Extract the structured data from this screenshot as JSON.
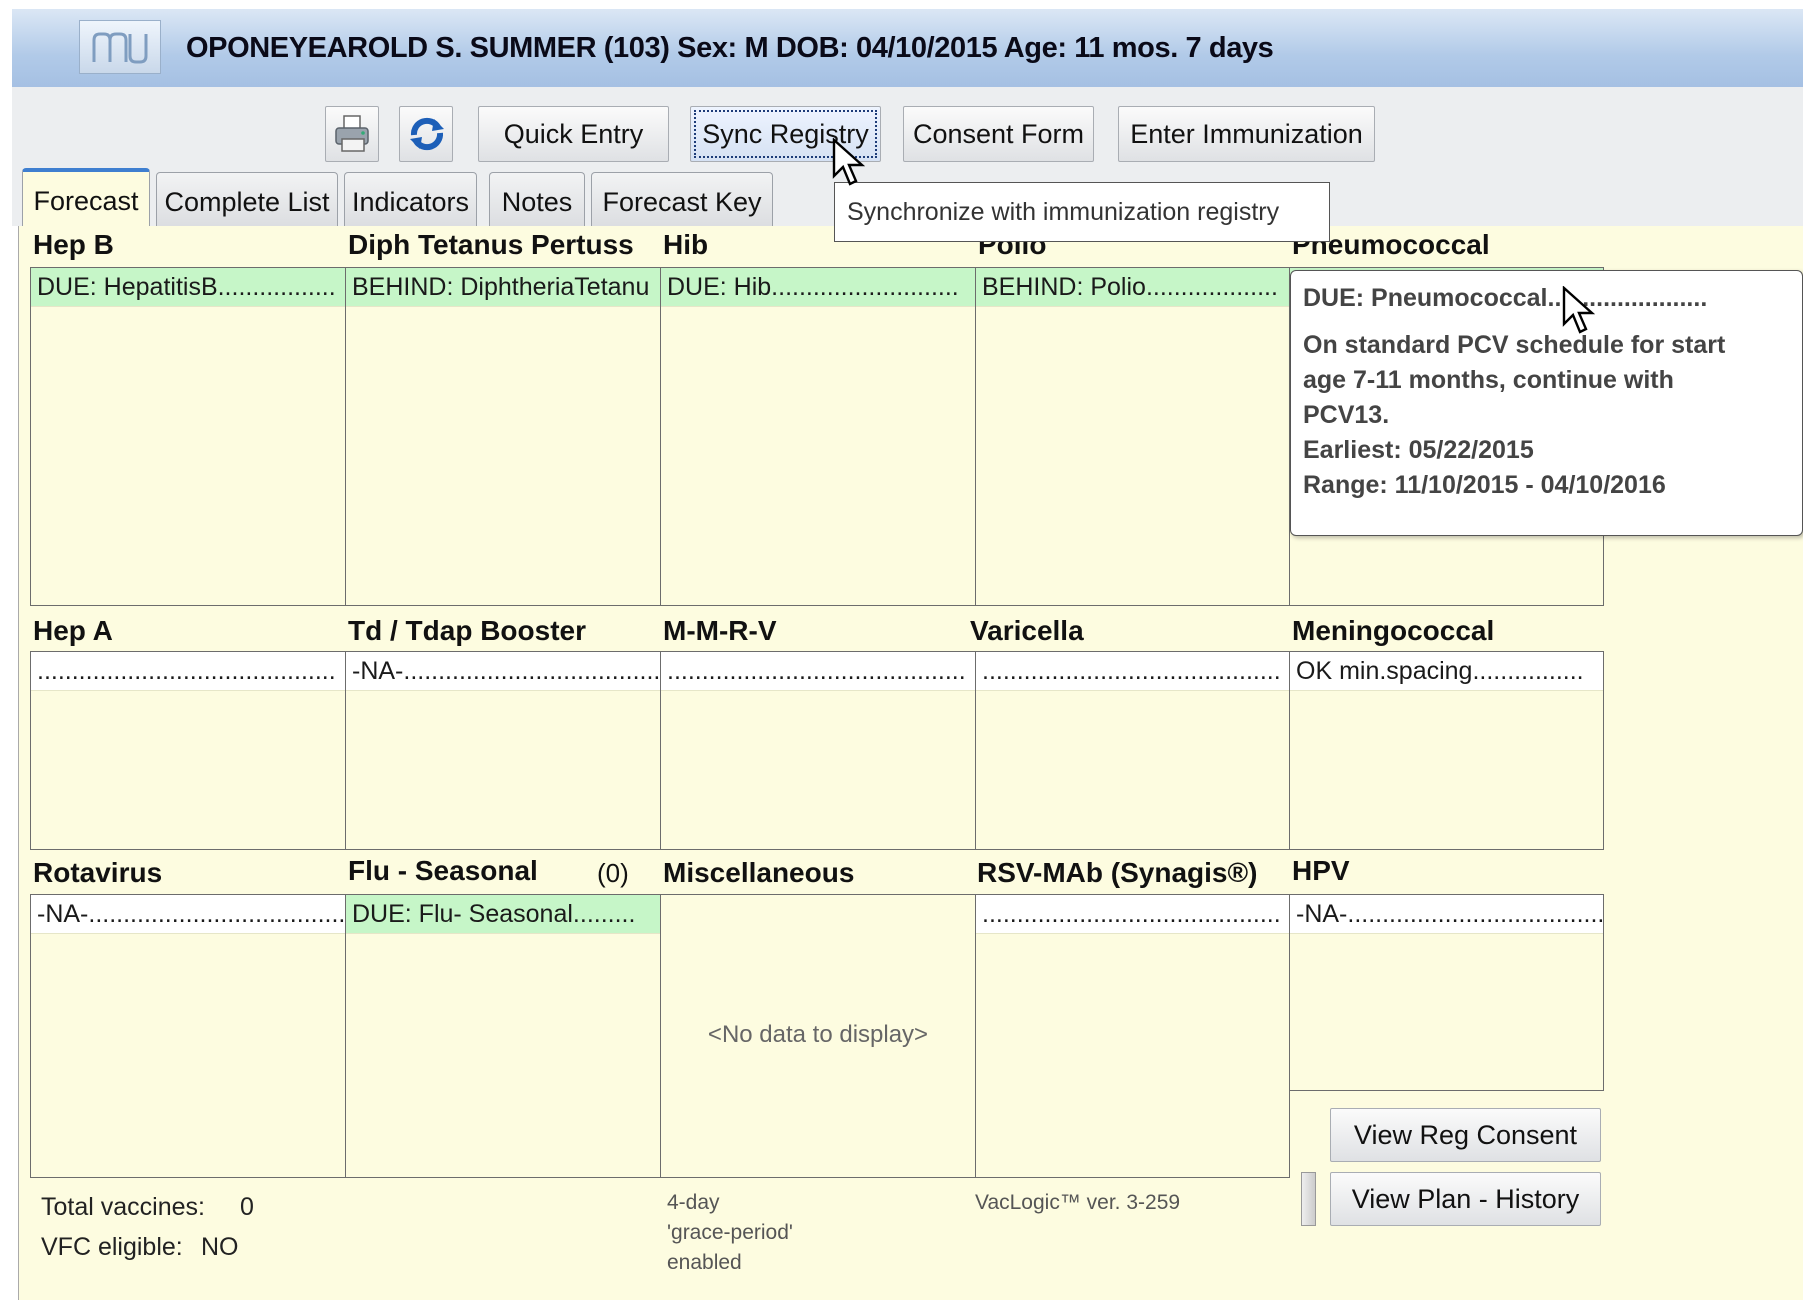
{
  "header": {
    "patient_line": "OPONEYEAROLD S. SUMMER (103)  Sex: M  DOB: 04/10/2015  Age: 11 mos. 7 days"
  },
  "toolbar": {
    "print_icon": "printer-icon",
    "refresh_icon": "refresh-icon",
    "quick_entry": "Quick Entry",
    "sync_registry": "Sync Registry",
    "consent_form": "Consent Form",
    "enter_immunization": "Enter Immunization"
  },
  "tabs": [
    {
      "label": "Forecast",
      "active": true
    },
    {
      "label": "Complete List"
    },
    {
      "label": "Indicators"
    },
    {
      "label": "Notes"
    },
    {
      "label": "Forecast Key"
    }
  ],
  "tooltip_sync": "Synchronize with immunization registry",
  "groups": {
    "row1": [
      {
        "title": "Hep B",
        "text": "DUE: HepatitisB.................",
        "status": "green"
      },
      {
        "title": "Diph Tetanus Pertuss",
        "text": "BEHIND: DiphtheriaTetanu",
        "status": "green"
      },
      {
        "title": "Hib",
        "text": "DUE: Hib...........................",
        "status": "green"
      },
      {
        "title": "Polio",
        "text": "BEHIND: Polio...................",
        "status": "green"
      },
      {
        "title": "Pneumococcal",
        "text": "",
        "status": "green"
      }
    ],
    "row2": [
      {
        "title": "Hep A",
        "text": "...........................................",
        "status": "white"
      },
      {
        "title": "Td / Tdap Booster",
        "text": "-NA-.....................................",
        "status": "white"
      },
      {
        "title": "M-M-R-V",
        "text": "...........................................",
        "status": "white"
      },
      {
        "title": "Varicella",
        "text": "...........................................",
        "status": "white"
      },
      {
        "title": "Meningococcal",
        "text": "OK min.spacing................",
        "status": "white"
      }
    ],
    "row3": [
      {
        "title": "Rotavirus",
        "text": "-NA-.....................................",
        "status": "white"
      },
      {
        "title": "Flu - Seasonal",
        "count": "(0)",
        "text": "DUE: Flu- Seasonal.........",
        "status": "green"
      },
      {
        "title": "Miscellaneous",
        "text": "<No data to display>",
        "status": "none"
      },
      {
        "title": "RSV-MAb (Synagis®)",
        "text": "...........................................",
        "status": "white"
      },
      {
        "title": "HPV",
        "text": "-NA-.....................................",
        "status": "white"
      }
    ]
  },
  "tooltip_pcv": {
    "title": "DUE: Pneumococcal.......................",
    "line1": "On standard PCV schedule for start",
    "line2": "age 7-11 months, continue with",
    "line3": "PCV13.",
    "earliest": "Earliest: 05/22/2015",
    "range": "Range: 11/10/2015 - 04/10/2016"
  },
  "footer": {
    "total_vaccines_label": "Total vaccines:",
    "total_vaccines_value": "0",
    "vfc_label": "VFC eligible:",
    "vfc_value": "NO",
    "grace_line1": "4-day",
    "grace_line2": "'grace-period'",
    "grace_line3": "enabled",
    "version": "VacLogic™  ver. 3-259"
  },
  "side_buttons": {
    "view_reg_consent": "View Reg Consent",
    "view_plan_history": "View Plan - History"
  },
  "colors": {
    "due_green": "#c6f6c8",
    "panel_yellow": "#fdfce0",
    "header_blue": "#b1cae8"
  }
}
